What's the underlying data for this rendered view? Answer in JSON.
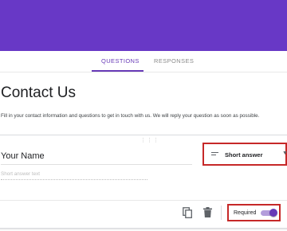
{
  "colors": {
    "brand": "#6838c6",
    "accent": "#673ab7",
    "highlight": "#c62828"
  },
  "tabs": [
    {
      "label": "QUESTIONS",
      "active": true
    },
    {
      "label": "RESPONSES",
      "active": false
    }
  ],
  "form": {
    "title": "Contact Us",
    "description": "Fill in your contact information and questions to get in touch with us. We will reply your question as soon as possible."
  },
  "question": {
    "title": "Your Name",
    "answer_placeholder": "Short answer text",
    "type_label": "Short answer",
    "type_icon": "short-text-icon",
    "required_label": "Required",
    "required": true,
    "actions": [
      "copy-icon",
      "trash-icon"
    ]
  }
}
